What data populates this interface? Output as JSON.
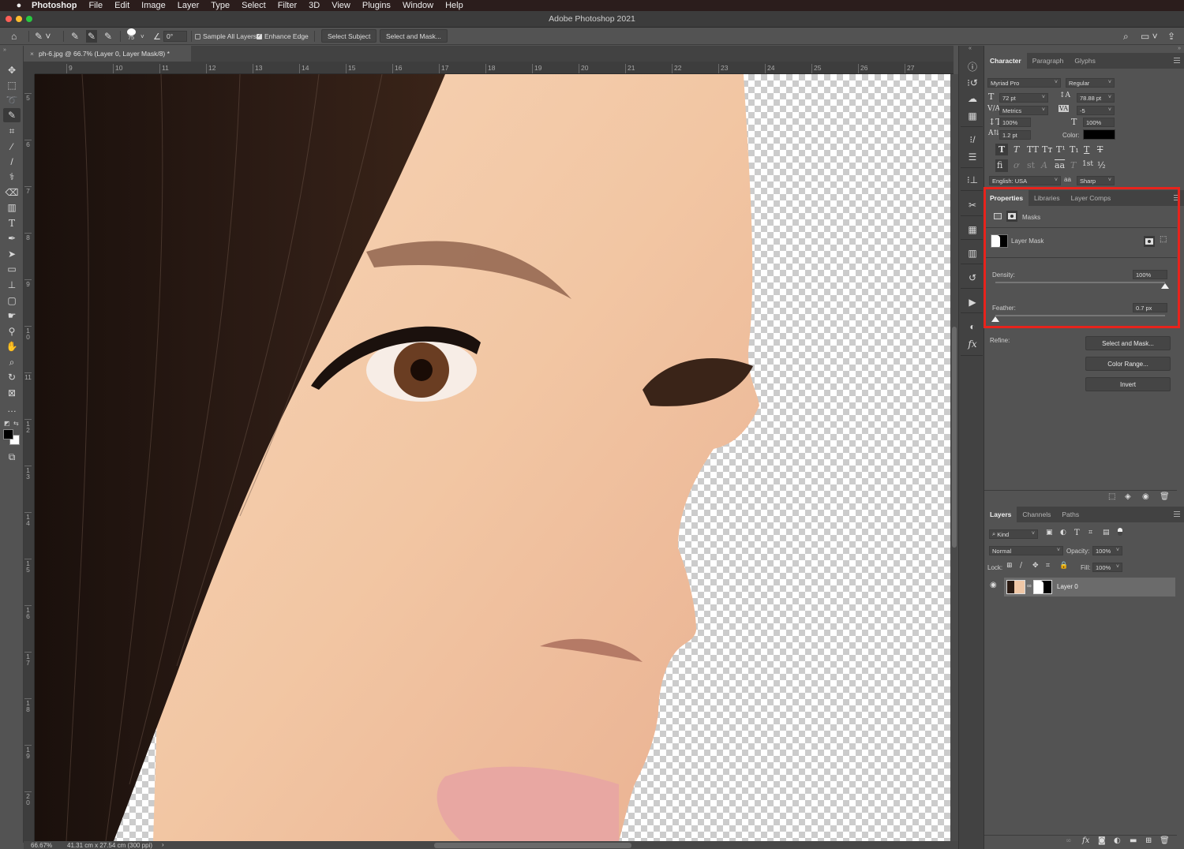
{
  "menubar": {
    "apple": "",
    "items": [
      "Photoshop",
      "File",
      "Edit",
      "Image",
      "Layer",
      "Type",
      "Select",
      "Filter",
      "3D",
      "View",
      "Plugins",
      "Window",
      "Help"
    ]
  },
  "titlebar": {
    "title": "Adobe Photoshop 2021"
  },
  "options_bar": {
    "brush_size": "75",
    "angle": "0°",
    "sample_all_layers": {
      "label": "Sample All Layers",
      "checked": false
    },
    "enhance_edge": {
      "label": "Enhance Edge",
      "checked": true
    },
    "select_subject": "Select Subject",
    "select_and_mask": "Select and Mask..."
  },
  "document": {
    "tab_title": "ph-6.jpg @ 66.7% (Layer 0, Layer Mask/8) *",
    "close": "×"
  },
  "rulers": {
    "horizontal": [
      "9",
      "10",
      "11",
      "12",
      "13",
      "14",
      "15",
      "16",
      "17",
      "18",
      "19",
      "20",
      "21",
      "22",
      "23",
      "24",
      "25",
      "26",
      "27"
    ],
    "vertical": [
      "5",
      "6",
      "7",
      "8",
      "9",
      "10",
      "11",
      "12",
      "13",
      "14",
      "15",
      "16",
      "17",
      "18",
      "19",
      "20"
    ]
  },
  "statusbar": {
    "zoom": "66.67%",
    "doc_size": "41.31 cm x 27.54 cm (300 ppi)",
    "arrow": "›"
  },
  "toolbar": {
    "tools": [
      "move",
      "marquee",
      "lasso",
      "quick-selection",
      "crop",
      "eyedropper",
      "brush",
      "healing",
      "eraser",
      "gradient",
      "type",
      "pen",
      "path-selection",
      "rectangle",
      "clone-stamp",
      "patch",
      "smudge",
      "dodge",
      "hand",
      "zoom",
      "rotate-view",
      "frame",
      "more",
      "swap-colors",
      "color-swatches",
      "screen-mode"
    ],
    "active": "quick-selection"
  },
  "character_panel": {
    "tabs": [
      "Character",
      "Paragraph",
      "Glyphs"
    ],
    "active_tab": "Character",
    "font_family": "Myriad Pro",
    "font_style": "Regular",
    "font_size": "72 pt",
    "leading": "78.88 pt",
    "kerning": "Metrics",
    "tracking": "-5",
    "vertical_scale": "100%",
    "horizontal_scale": "100%",
    "baseline_shift": "1.2 pt",
    "color_label": "Color:",
    "color": "#000000",
    "language": "English: USA",
    "antialias_icon": "aa",
    "antialias": "Sharp",
    "style_buttons": [
      "T",
      "T",
      "TT",
      "Tт",
      "T¹",
      "T₁",
      "T",
      "T"
    ],
    "opentype_buttons": [
      "fi",
      "ơ",
      "st",
      "A",
      "aa",
      "T",
      "1st",
      "½"
    ]
  },
  "properties_panel": {
    "tabs": [
      "Properties",
      "Libraries",
      "Layer Comps"
    ],
    "active_tab": "Properties",
    "section": "Masks",
    "mask_name": "Layer Mask",
    "density_label": "Density:",
    "density_value": "100%",
    "density_fraction": 1.0,
    "feather_label": "Feather:",
    "feather_value": "0.7 px",
    "feather_fraction": 0.0,
    "refine_label": "Refine:",
    "buttons": [
      "Select and Mask...",
      "Color Range...",
      "Invert"
    ],
    "highlight_color": "#e8231c"
  },
  "layers_panel": {
    "tabs": [
      "Layers",
      "Channels",
      "Paths"
    ],
    "active_tab": "Layers",
    "filter_kind": "Kind",
    "blend_mode": "Normal",
    "opacity_label": "Opacity:",
    "opacity": "100%",
    "lock_label": "Lock:",
    "fill_label": "Fill:",
    "fill": "100%",
    "layers": [
      {
        "name": "Layer 0",
        "visible": true,
        "has_mask": true
      }
    ]
  }
}
